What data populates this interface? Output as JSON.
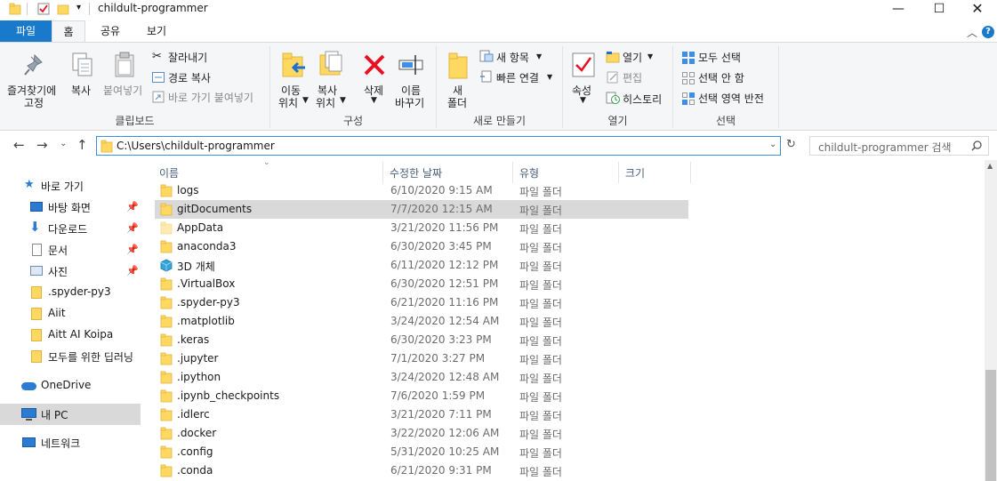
{
  "window": {
    "title": "childult-programmer",
    "controls": [
      "minimize",
      "maximize",
      "close"
    ]
  },
  "ribbon_tabs": [
    {
      "label": "파일"
    },
    {
      "label": "홈"
    },
    {
      "label": "공유"
    },
    {
      "label": "보기"
    }
  ],
  "ribbon": {
    "clipboard": {
      "pin_label_1": "즐겨찾기에",
      "pin_label_2": "고정",
      "copy": "복사",
      "paste": "붙여넣기",
      "cut": "잘라내기",
      "copy_path": "경로 복사",
      "paste_shortcut": "바로 가기 붙여넣기",
      "group": "클립보드"
    },
    "organize": {
      "move_1": "이동",
      "move_2": "위치",
      "copyto_1": "복사",
      "copyto_2": "위치",
      "delete": "삭제",
      "rename_1": "이름",
      "rename_2": "바꾸기",
      "group": "구성"
    },
    "new": {
      "new_folder_1": "새",
      "new_folder_2": "폴더",
      "new_item": "새 항목",
      "easy_access": "빠른 연결",
      "group": "새로 만들기"
    },
    "open": {
      "properties": "속성",
      "open": "열기",
      "edit": "편집",
      "history": "히스토리",
      "group": "열기"
    },
    "select": {
      "select_all": "모두 선택",
      "select_none": "선택 안 함",
      "invert": "선택 영역 반전",
      "group": "선택"
    }
  },
  "address": {
    "path": "C:\\Users\\childult-programmer",
    "search_placeholder": "childult-programmer 검색"
  },
  "nav": {
    "quick_access": "바로 가기",
    "items": [
      {
        "label": "바탕 화면",
        "pinned": true
      },
      {
        "label": "다운로드",
        "pinned": true
      },
      {
        "label": "문서",
        "pinned": true
      },
      {
        "label": "사진",
        "pinned": true
      },
      {
        "label": ".spyder-py3",
        "pinned": false
      },
      {
        "label": "Aiit",
        "pinned": false
      },
      {
        "label": "Aitt AI Koipa",
        "pinned": false
      },
      {
        "label": "모두를 위한 딥러닝",
        "pinned": false
      }
    ],
    "onedrive": "OneDrive",
    "thispc": "내 PC",
    "network": "네트워크"
  },
  "columns": {
    "name": "이름",
    "date": "수정한 날짜",
    "type": "유형",
    "size": "크기"
  },
  "files": [
    {
      "name": "logs",
      "date": "6/10/2020 9:15 AM",
      "type": "파일 폴더",
      "icon": "folder-icon"
    },
    {
      "name": "gitDocuments",
      "date": "7/7/2020 12:15 AM",
      "type": "파일 폴더",
      "icon": "folder-icon",
      "selected": true
    },
    {
      "name": "AppData",
      "date": "3/21/2020 11:56 PM",
      "type": "파일 폴더",
      "icon": "hidden-folder-icon"
    },
    {
      "name": "anaconda3",
      "date": "6/30/2020 3:45 PM",
      "type": "파일 폴더",
      "icon": "folder-icon"
    },
    {
      "name": "3D 개체",
      "date": "6/11/2020 12:12 PM",
      "type": "파일 폴더",
      "icon": "3d-objects-icon"
    },
    {
      "name": ".VirtualBox",
      "date": "6/30/2020 12:51 PM",
      "type": "파일 폴더",
      "icon": "folder-icon"
    },
    {
      "name": ".spyder-py3",
      "date": "6/21/2020 11:16 PM",
      "type": "파일 폴더",
      "icon": "folder-icon"
    },
    {
      "name": ".matplotlib",
      "date": "3/24/2020 12:54 AM",
      "type": "파일 폴더",
      "icon": "folder-icon"
    },
    {
      "name": ".keras",
      "date": "6/30/2020 3:23 PM",
      "type": "파일 폴더",
      "icon": "folder-icon"
    },
    {
      "name": ".jupyter",
      "date": "7/1/2020 3:27 PM",
      "type": "파일 폴더",
      "icon": "folder-icon"
    },
    {
      "name": ".ipython",
      "date": "3/24/2020 12:48 AM",
      "type": "파일 폴더",
      "icon": "folder-icon"
    },
    {
      "name": ".ipynb_checkpoints",
      "date": "7/6/2020 1:59 PM",
      "type": "파일 폴더",
      "icon": "folder-icon"
    },
    {
      "name": ".idlerc",
      "date": "3/21/2020 7:11 PM",
      "type": "파일 폴더",
      "icon": "folder-icon"
    },
    {
      "name": ".docker",
      "date": "3/22/2020 12:06 AM",
      "type": "파일 폴더",
      "icon": "folder-icon"
    },
    {
      "name": ".config",
      "date": "5/31/2020 10:25 AM",
      "type": "파일 폴더",
      "icon": "folder-icon"
    },
    {
      "name": ".conda",
      "date": "6/21/2020 9:31 PM",
      "type": "파일 폴더",
      "icon": "folder-icon"
    }
  ],
  "colors": {
    "accent": "#1979ca",
    "folder": "#ffd861",
    "selected_row": "#d9d9d9",
    "delete_red": "#e81123"
  }
}
